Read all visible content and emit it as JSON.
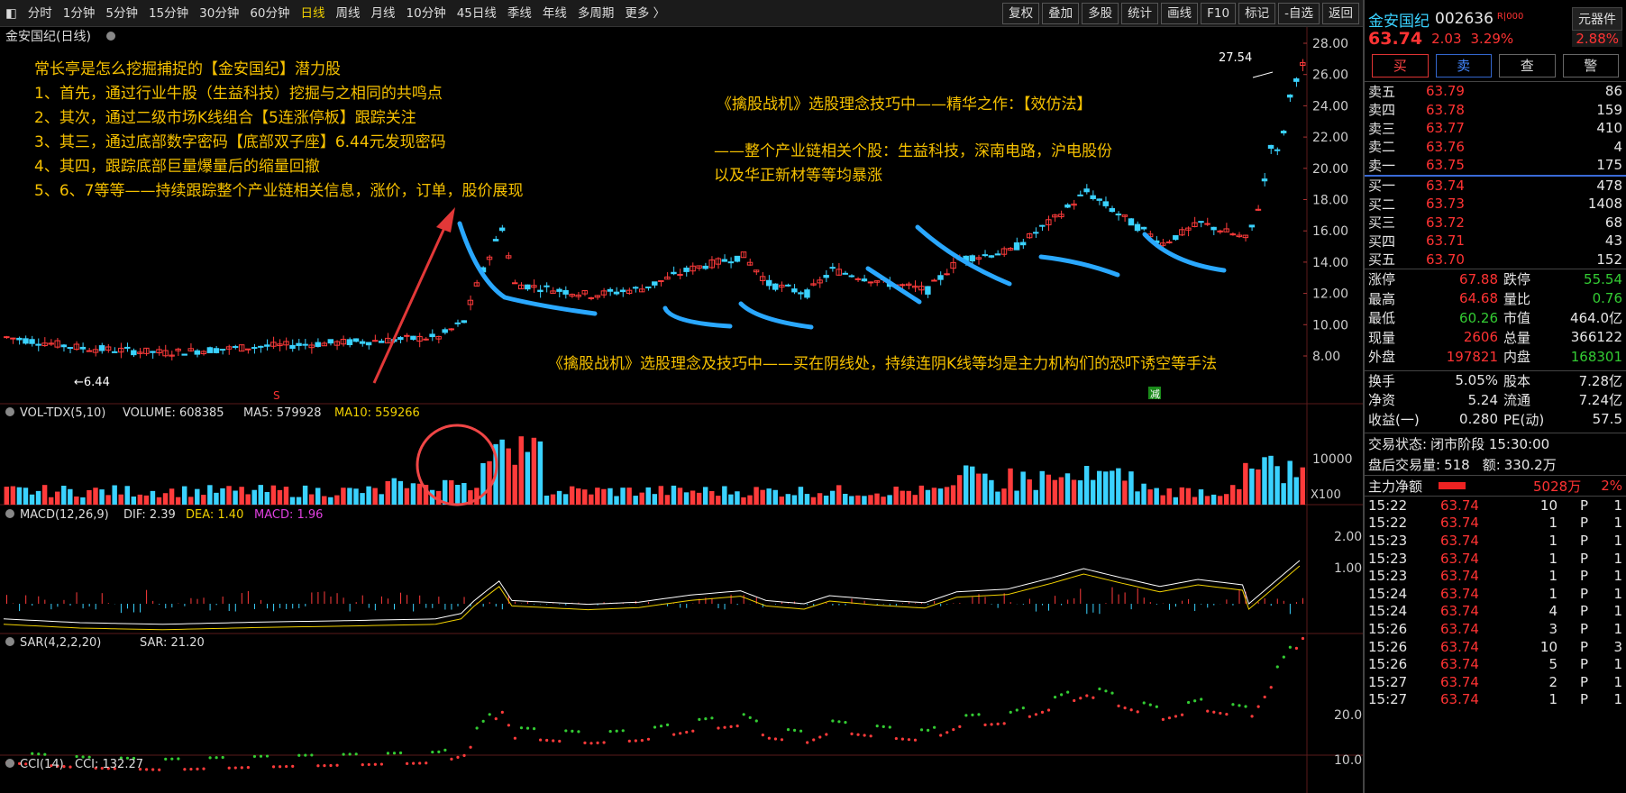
{
  "tabs": [
    "分时",
    "1分钟",
    "5分钟",
    "15分钟",
    "30分钟",
    "60分钟",
    "日线",
    "周线",
    "月线",
    "10分钟",
    "45日线",
    "季线",
    "年线",
    "多周期",
    "更多 〉"
  ],
  "active_tab": "日线",
  "tools": [
    "复权",
    "叠加",
    "多股",
    "统计",
    "画线",
    "F10",
    "标记",
    "-自选",
    "返回"
  ],
  "chart_title": "金安国纪(日线)",
  "price_axis": [
    "28.00",
    "26.00",
    "24.00",
    "22.00",
    "20.00",
    "18.00",
    "16.00",
    "14.00",
    "12.00",
    "10.00",
    "8.00"
  ],
  "low_label": "←6.44",
  "high_label": "27.54",
  "marker_s": "S",
  "marker_jian": "减",
  "annotations": {
    "left": [
      "常长亭是怎么挖掘捕捉的【金安国纪】潜力股",
      "1、首先，通过行业牛股（生益科技）挖掘与之相同的共鸣点",
      "2、其次，通过二级市场K线组合【5连涨停板】跟踪关注",
      "3、其三，通过底部数字密码【底部双子座】6.44元发现密码",
      "4、其四，跟踪底部巨量爆量后的缩量回撤",
      "5、6、7等等——持续跟踪整个产业链相关信息，涨价，订单，股价展现"
    ],
    "mid1": "《擒股战机》选股理念技巧中——精华之作：【效仿法】",
    "mid2": [
      "——整个产业链相关个股：生益科技，深南电路，沪电股份",
      "以及华正新材等等均暴涨"
    ],
    "mid3": "《擒股战机》选股理念及技巧中——买在阴线处，持续连阴K线等均是主力机构们的恐吓诱空等手法"
  },
  "vol": {
    "label": "VOL-TDX(5,10)",
    "vol": "VOLUME: 608385",
    "ma5": "MA5: 579928",
    "ma10": "MA10: 559266",
    "axis": "10000",
    "unit": "X100"
  },
  "macd": {
    "label": "MACD(12,26,9)",
    "dif": "DIF: 2.39",
    "dea": "DEA: 1.40",
    "macd": "MACD: 1.96",
    "axis": [
      "2.00",
      "1.00"
    ]
  },
  "sar": {
    "label": "SAR(4,2,2,20)",
    "val": "SAR: 21.20",
    "axis": [
      "20.00",
      "10.00"
    ]
  },
  "cci": {
    "label": "CCI(14)",
    "val": "CCI: 132.27"
  },
  "panel": {
    "name": "金安国纪",
    "code": "002636",
    "badge": "R|000",
    "component": "元器件",
    "price": "63.74",
    "change": "2.03",
    "pct": "3.29%",
    "pct2": "2.88%",
    "buttons": [
      "买",
      "卖",
      "查",
      "警"
    ],
    "asks": [
      [
        "卖五",
        "63.79",
        "86"
      ],
      [
        "卖四",
        "63.78",
        "159"
      ],
      [
        "卖三",
        "63.77",
        "410"
      ],
      [
        "卖二",
        "63.76",
        "4"
      ],
      [
        "卖一",
        "63.75",
        "175"
      ]
    ],
    "bids": [
      [
        "买一",
        "63.74",
        "478"
      ],
      [
        "买二",
        "63.73",
        "1408"
      ],
      [
        "买三",
        "63.72",
        "68"
      ],
      [
        "买四",
        "63.71",
        "43"
      ],
      [
        "买五",
        "63.70",
        "152"
      ]
    ],
    "stats": [
      [
        "涨停",
        "67.88",
        "跌停",
        "55.54"
      ],
      [
        "最高",
        "64.68",
        "量比",
        "0.76"
      ],
      [
        "最低",
        "60.26",
        "市值",
        "464.0亿"
      ],
      [
        "现量",
        "2606",
        "总量",
        "366122"
      ],
      [
        "外盘",
        "197821",
        "内盘",
        "168301"
      ]
    ],
    "fin": [
      [
        "换手",
        "5.05%",
        "股本",
        "7.28亿"
      ],
      [
        "净资",
        "5.24",
        "流通",
        "7.24亿"
      ],
      [
        "收益(一)",
        "0.280",
        "PE(动)",
        "57.5"
      ]
    ],
    "status_label": "交易状态:",
    "status_val": "闭市阶段 15:30:00",
    "after_label": "盘后交易量:",
    "after_val": "518",
    "amt_label": "额:",
    "amt_val": "330.2万",
    "flow_label": "主力净额",
    "flow_val": "5028万",
    "flow_pct": "2%",
    "ticks": [
      [
        "15:22",
        "63.74",
        "10",
        "P",
        "1"
      ],
      [
        "15:22",
        "63.74",
        "1",
        "P",
        "1"
      ],
      [
        "15:23",
        "63.74",
        "1",
        "P",
        "1"
      ],
      [
        "15:23",
        "63.74",
        "1",
        "P",
        "1"
      ],
      [
        "15:23",
        "63.74",
        "1",
        "P",
        "1"
      ],
      [
        "15:24",
        "63.74",
        "1",
        "P",
        "1"
      ],
      [
        "15:24",
        "63.74",
        "4",
        "P",
        "1"
      ],
      [
        "15:26",
        "63.74",
        "3",
        "P",
        "1"
      ],
      [
        "15:26",
        "63.74",
        "10",
        "P",
        "3"
      ],
      [
        "15:26",
        "63.74",
        "5",
        "P",
        "1"
      ],
      [
        "15:27",
        "63.74",
        "2",
        "P",
        "1"
      ],
      [
        "15:27",
        "63.74",
        "1",
        "P",
        "1"
      ]
    ]
  }
}
